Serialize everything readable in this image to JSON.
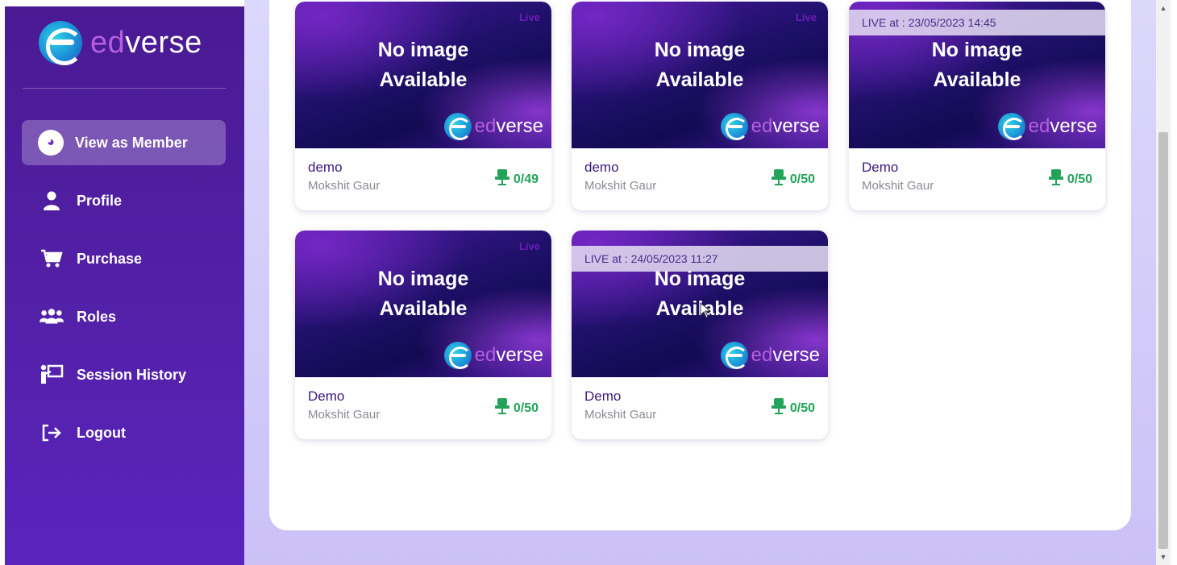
{
  "brand": {
    "ed": "ed",
    "verse": "verse"
  },
  "sidebar": {
    "items": [
      {
        "label": "View as Member",
        "icon": "gauge-icon",
        "active": true
      },
      {
        "label": "Profile",
        "icon": "user-icon"
      },
      {
        "label": "Purchase",
        "icon": "cart-icon"
      },
      {
        "label": "Roles",
        "icon": "group-icon"
      },
      {
        "label": "Session History",
        "icon": "presentation-icon"
      },
      {
        "label": "Logout",
        "icon": "logout-icon"
      }
    ]
  },
  "sessions": [
    {
      "thumb_line1": "No image",
      "thumb_line2": "Available",
      "status": "Live",
      "title": "demo",
      "host": "Mokshit Gaur",
      "seats": "0/49"
    },
    {
      "thumb_line1": "No image",
      "thumb_line2": "Available",
      "status": "Live",
      "title": "demo",
      "host": "Mokshit Gaur",
      "seats": "0/50"
    },
    {
      "thumb_line1": "No image",
      "thumb_line2": "Available",
      "banner": "LIVE at : 23/05/2023 14:45",
      "title": "Demo",
      "host": "Mokshit Gaur",
      "seats": "0/50"
    },
    {
      "thumb_line1": "No image",
      "thumb_line2": "Available",
      "status": "Live",
      "title": "Demo",
      "host": "Mokshit Gaur",
      "seats": "0/50"
    },
    {
      "thumb_line1": "No image",
      "thumb_line2": "Available",
      "banner": "LIVE at : 24/05/2023 11:27",
      "title": "Demo",
      "host": "Mokshit Gaur",
      "seats": "0/50"
    }
  ],
  "colors": {
    "sidebar": "#5320a8",
    "accent_green": "#22a35a",
    "brand_ed": "#b45fe0"
  }
}
